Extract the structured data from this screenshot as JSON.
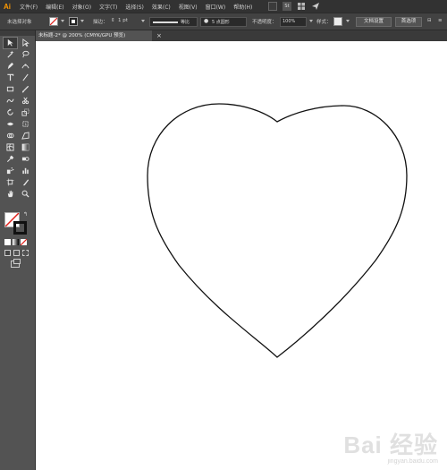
{
  "app": {
    "logo": "Ai"
  },
  "menu": [
    "文件(F)",
    "编辑(E)",
    "对象(O)",
    "文字(T)",
    "选择(S)",
    "效果(C)",
    "视图(V)",
    "窗口(W)",
    "帮助(H)"
  ],
  "menubar_right": {
    "st_label": "St"
  },
  "control": {
    "selection_status": "未选择对象",
    "stroke_label": "描边：",
    "stroke_weight": "1 pt",
    "profile_label": "等比",
    "brush_label": "5 点圆形",
    "opacity_label": "不透明度：",
    "opacity_value": "100%",
    "style_label": "样式：",
    "doc_settings_button": "文档设置",
    "preferences_button": "首选项"
  },
  "document_tab": {
    "title": "未标题-2* @ 200% (CMYK/GPU 预览)",
    "close": "×"
  },
  "watermark": {
    "brand": "Bai 经验",
    "url": "jingyan.baidu.com"
  },
  "colors": {
    "menubar": "#323232",
    "controlbar": "#424242",
    "toolbox": "#535353",
    "accent": "#ff9a00",
    "fill_none_slash": "#e0201b"
  },
  "tools": [
    "selection-icon",
    "direct-selection-icon",
    "magic-wand-icon",
    "lasso-icon",
    "pen-icon",
    "curvature-icon",
    "type-icon",
    "line-icon",
    "rectangle-icon",
    "paintbrush-icon",
    "shaper-icon",
    "eraser-icon",
    "rotate-icon",
    "scale-icon",
    "width-icon",
    "free-transform-icon",
    "shape-builder-icon",
    "perspective-icon",
    "mesh-icon",
    "gradient-icon",
    "eyedropper-icon",
    "blend-icon",
    "symbol-sprayer-icon",
    "graph-icon",
    "artboard-icon",
    "slice-icon",
    "hand-icon",
    "zoom-icon"
  ]
}
